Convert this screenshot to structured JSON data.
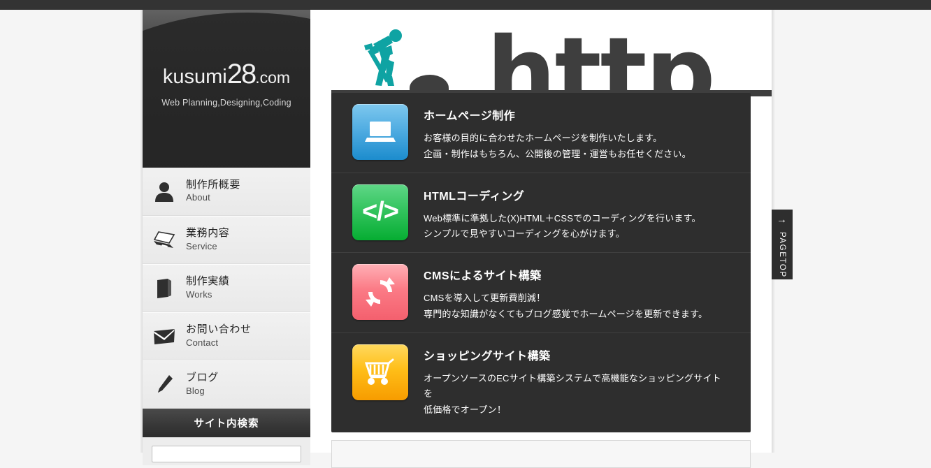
{
  "brand": {
    "name_prefix": "kusumi",
    "name_number": "28",
    "name_suffix": ".com",
    "tagline": "Web Planning,Designing,Coding"
  },
  "nav": {
    "items": [
      {
        "ja": "制作所概要",
        "en": "About",
        "icon": "person-icon"
      },
      {
        "ja": "業務内容",
        "en": "Service",
        "icon": "laptop-icon"
      },
      {
        "ja": "制作実績",
        "en": "Works",
        "icon": "book-icon"
      },
      {
        "ja": "お問い合わせ",
        "en": "Contact",
        "icon": "envelope-icon"
      },
      {
        "ja": "ブログ",
        "en": "Blog",
        "icon": "pencil-icon"
      }
    ]
  },
  "search": {
    "heading": "サイト内検索",
    "value": "",
    "placeholder": ""
  },
  "banner": {
    "text": "http",
    "worker_icon": "construction-worker-icon",
    "worker_color": "#0fa3a3",
    "text_color": "#3e3e3e"
  },
  "services": {
    "items": [
      {
        "icon": "laptop-icon",
        "icon_color": "#1c8ccd",
        "title": "ホームページ制作",
        "lines": [
          "お客様の目的に合わせたホームページを制作いたします。",
          "企画・制作はもちろん、公開後の管理・運営もお任せください。"
        ]
      },
      {
        "icon": "code-tag-icon",
        "icon_color": "#06ad32",
        "icon_text": "</>",
        "title": "HTMLコーディング",
        "lines": [
          "Web標準に準拠した(X)HTML＋CSSでのコーディングを行います。",
          "シンプルで見やすいコーディングを心がけます。"
        ]
      },
      {
        "icon": "refresh-icon",
        "icon_color": "#f4606e",
        "title": "CMSによるサイト構築",
        "lines": [
          "CMSを導入して更新費削減！",
          "専門的な知識がなくてもブログ感覚でホームページを更新できます。"
        ]
      },
      {
        "icon": "shopping-cart-icon",
        "icon_color": "#f79c00",
        "title": "ショッピングサイト構築",
        "lines": [
          "オープンソースのECサイト構築システムで高機能なショッピングサイトを",
          "低価格でオープン！"
        ]
      }
    ]
  },
  "pagetop": {
    "label": "PAGETOP",
    "arrow": "↑"
  }
}
